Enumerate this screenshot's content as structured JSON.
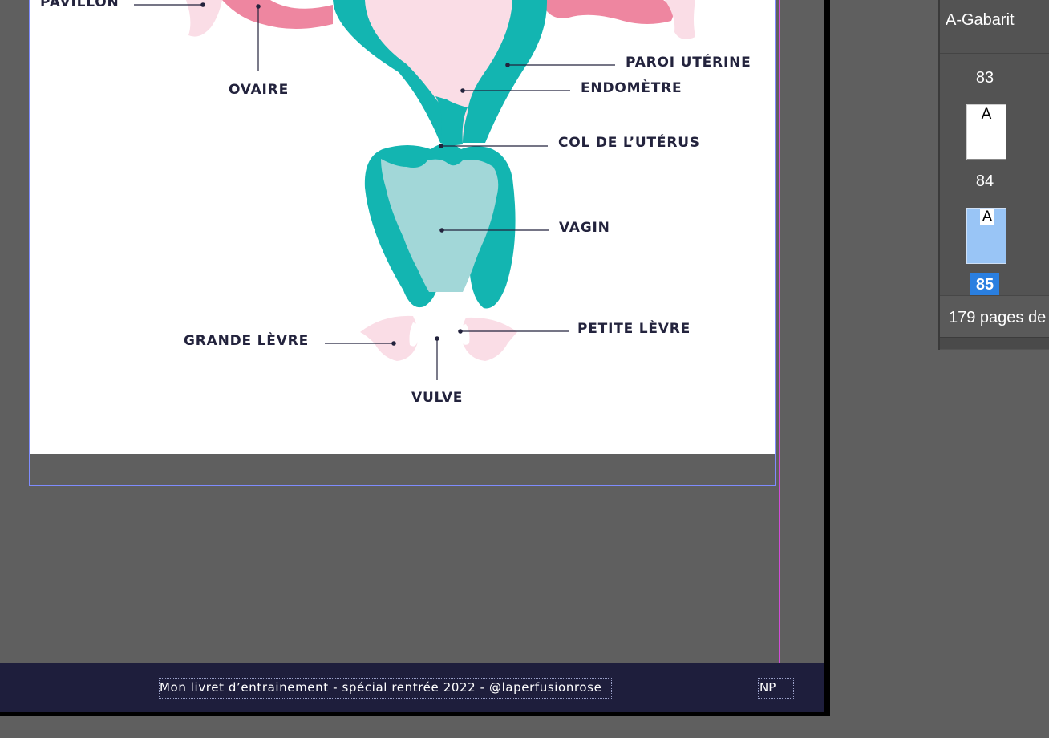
{
  "diagram": {
    "labels": {
      "pavillon": "PAVILLON",
      "ovaire": "OVAIRE",
      "paroi": "PAROI UTÉRINE",
      "endometre": "ENDOMÈTRE",
      "col": "COL DE L’UTÉRUS",
      "vagin": "VAGIN",
      "grande_levre": "GRANDE LÈVRE",
      "petite_levre": "PETITE LÈVRE",
      "vulve": "VULVE"
    },
    "colors": {
      "teal": "#13b5b1",
      "light_teal": "#a2d7d8",
      "pink": "#ee86a0",
      "light_pink": "#fadde6",
      "label": "#23233d"
    }
  },
  "footer": {
    "text": "Mon livret d’entrainement - spécial rentrée 2022 - @laperfusionrose",
    "page_marker": "NP"
  },
  "pages_panel": {
    "master": "A-Gabarit",
    "pages": [
      {
        "number": "83",
        "master_letter": "A"
      },
      {
        "number": "84",
        "master_letter": "A"
      },
      {
        "number": "85"
      }
    ],
    "status": "179 pages de"
  }
}
